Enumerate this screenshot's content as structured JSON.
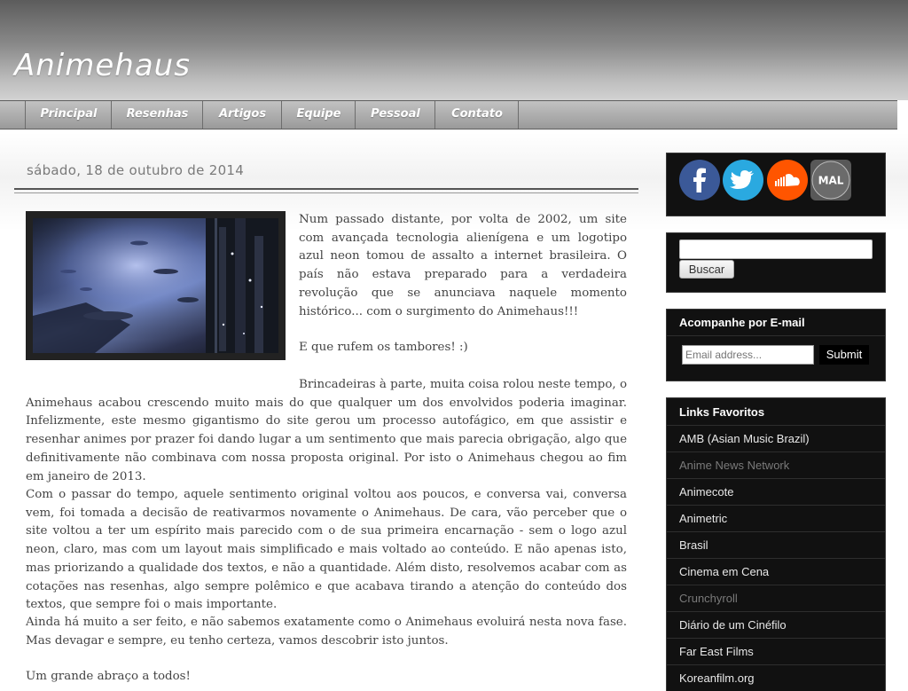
{
  "header": {
    "title": "Animehaus"
  },
  "nav": {
    "items": [
      "Principal",
      "Resenhas",
      "Artigos",
      "Equipe",
      "Pessoal",
      "Contato"
    ]
  },
  "post": {
    "date": "sábado, 18 de outubro de 2014",
    "paragraphs": [
      "Num passado distante, por volta de 2002, um site com avançada tecnologia alienígena e um logotipo azul neon tomou de assalto a internet brasileira. O país não estava preparado para a verdadeira revolução que se anunciava naquele momento histórico... com o surgimento do Animehaus!!!",
      "E que rufem os tambores! :)",
      "Brincadeiras à parte, muita coisa rolou neste tempo, o Animehaus acabou crescendo muito mais do que qualquer um dos envolvidos poderia imaginar. Infelizmente, este mesmo gigantismo do site gerou um processo autofágico, em que assistir e resenhar animes por prazer foi dando lugar a um sentimento que mais parecia obrigação, algo que definitivamente não combinava com nossa proposta original. Por isto o Animehaus chegou ao fim em janeiro de 2013.",
      "Com o passar do tempo, aquele sentimento original voltou aos poucos, e conversa vai, conversa vem, foi tomada a decisão de reativarmos novamente o Animehaus. De cara, vão perceber que o site voltou a ter um espírito mais parecido com o de sua primeira encarnação - sem o logo azul neon, claro, mas com um layout mais simplificado e mais voltado ao conteúdo. E não apenas isto, mas priorizando a qualidade dos textos, e não a quantidade. Além disto, resolvemos acabar com as cotações nas resenhas, algo sempre polêmico e que acabava tirando a atenção do conteúdo dos textos, que sempre foi o mais importante.",
      "Ainda há muito a ser feito, e não sabemos exatamente como o Animehaus evoluirá nesta nova fase. Mas devagar e sempre, eu tenho certeza, vamos descobrir isto juntos.",
      "Um grande abraço a todos!"
    ]
  },
  "sidebar": {
    "social": [
      {
        "name": "facebook",
        "glyph": "f",
        "color": "#3b5998"
      },
      {
        "name": "twitter",
        "glyph": "🐦",
        "color": "#2aa9e0"
      },
      {
        "name": "soundcloud",
        "glyph": "☁",
        "color": "#ff5500"
      },
      {
        "name": "myanimelist",
        "glyph": "MAL",
        "color": "#6b6b6b"
      }
    ],
    "search": {
      "value": "",
      "button": "Buscar"
    },
    "email": {
      "title": "Acompanhe por E-mail",
      "placeholder": "Email address...",
      "button": "Submit"
    },
    "links": {
      "title": "Links Favoritos",
      "items": [
        {
          "label": "AMB (Asian Music Brazil)",
          "muted": false
        },
        {
          "label": "Anime News Network",
          "muted": true
        },
        {
          "label": "Animecote",
          "muted": false
        },
        {
          "label": "Animetric",
          "muted": false
        },
        {
          "label": "Brasil",
          "muted": false
        },
        {
          "label": "Cinema em Cena",
          "muted": false
        },
        {
          "label": "Crunchyroll",
          "muted": true
        },
        {
          "label": "Diário de um Cinéfilo",
          "muted": false
        },
        {
          "label": "Far East Films",
          "muted": false
        },
        {
          "label": "Koreanfilm.org",
          "muted": false
        }
      ]
    }
  }
}
